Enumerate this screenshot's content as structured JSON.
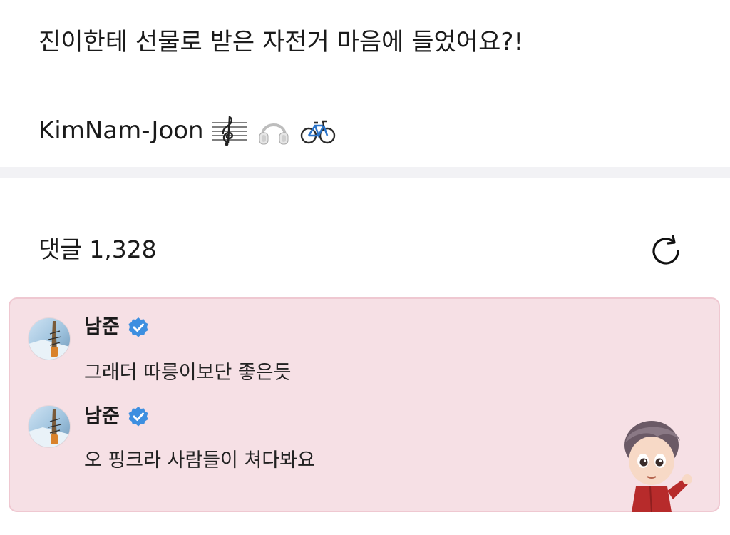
{
  "post": {
    "line1": "진이한테 선물로 받은 자전거 마음에 들었어요?!",
    "author_tag": "KimNam-Joon",
    "emojis": [
      "musical-score-icon",
      "headphones-icon",
      "bicycle-icon"
    ]
  },
  "comments_section": {
    "label": "댓글 1,328",
    "refresh_icon": "refresh-icon"
  },
  "highlight": {
    "accent_bg": "#f6e0e5",
    "accent_border": "#efc8d1",
    "comments": [
      {
        "name": "남준",
        "verified": true,
        "text": "그래더 따릉이보단 좋은듯"
      },
      {
        "name": "남준",
        "verified": true,
        "text": "오 핑크라 사람들이 쳐다봐요"
      }
    ],
    "verified_color": "#3d8fe0"
  }
}
